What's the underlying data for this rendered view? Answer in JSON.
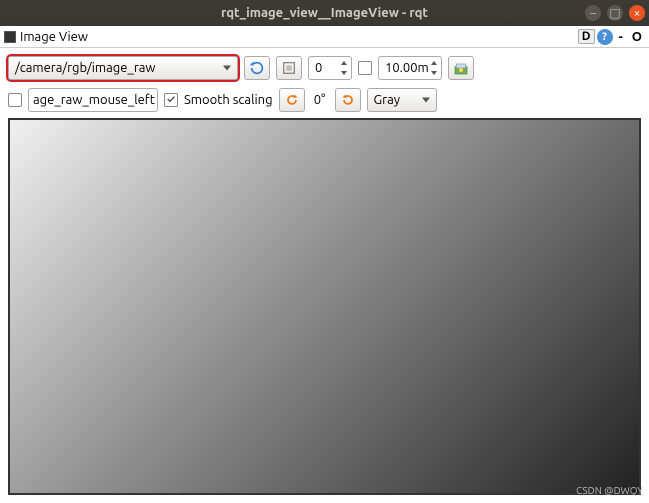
{
  "window": {
    "title": "rqt_image_view__ImageView - rqt"
  },
  "plugin": {
    "title": "Image View",
    "d_label": "D"
  },
  "toolbar": {
    "topic": "/camera/rgb/image_raw",
    "zoom_value": "0",
    "range_value": "10.00m",
    "mouse_topic_text": "age_raw_mouse_left",
    "smooth_label": "Smooth scaling",
    "smooth_checked": true,
    "rotation_deg": "0°",
    "colormap": "Gray"
  },
  "watermark": "CSDN @DWQY"
}
